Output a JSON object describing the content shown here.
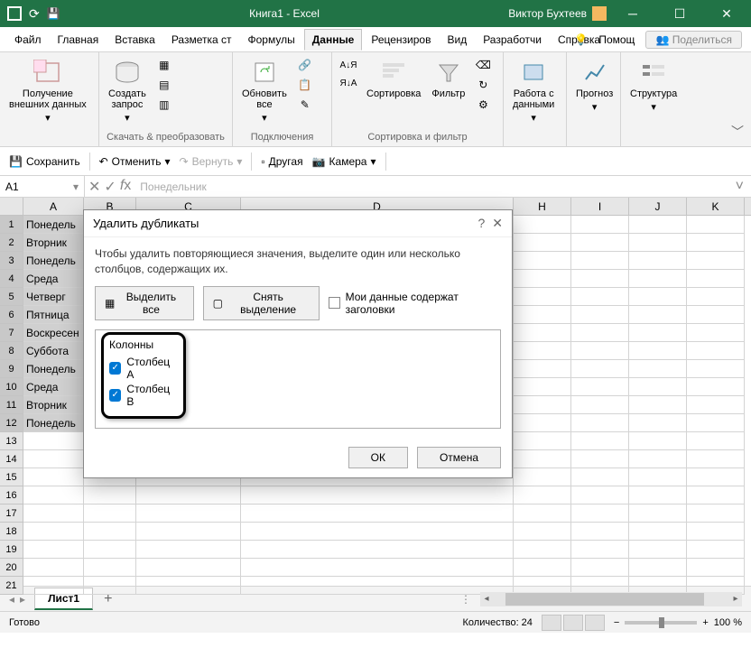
{
  "titlebar": {
    "filename": "Книга1 - Excel",
    "username": "Виктор Бухтеев"
  },
  "menu": {
    "items": [
      "Файл",
      "Главная",
      "Вставка",
      "Разметка ст",
      "Формулы",
      "Данные",
      "Рецензиров",
      "Вид",
      "Разработчи",
      "Справка"
    ],
    "active_index": 5,
    "help": "Помощ",
    "share": "Поделиться"
  },
  "ribbon": {
    "g1": {
      "btn": "Получение\nвнешних данных",
      "label": ""
    },
    "g2": {
      "btn": "Создать\nзапрос",
      "label": "Скачать & преобразовать"
    },
    "g3": {
      "btn": "Обновить\nвсе",
      "label": "Подключения"
    },
    "g4": {
      "sort": "Сортировка",
      "filter": "Фильтр",
      "label": "Сортировка и фильтр"
    },
    "g5": {
      "btn": "Работа с\nданными"
    },
    "g6": {
      "btn": "Прогноз"
    },
    "g7": {
      "btn": "Структура"
    }
  },
  "qat": {
    "save": "Сохранить",
    "undo": "Отменить",
    "redo": "Вернуть",
    "other": "Другая",
    "camera": "Камера"
  },
  "formula": {
    "namebox": "A1",
    "value": "Понедельник"
  },
  "columns": [
    "A",
    "B",
    "C",
    "D",
    "H",
    "I",
    "J",
    "K"
  ],
  "rows": [
    {
      "n": "1",
      "a": "Понедель"
    },
    {
      "n": "2",
      "a": "Вторник"
    },
    {
      "n": "3",
      "a": "Понедель"
    },
    {
      "n": "4",
      "a": "Среда"
    },
    {
      "n": "5",
      "a": "Четверг"
    },
    {
      "n": "6",
      "a": "Пятница"
    },
    {
      "n": "7",
      "a": "Воскресен"
    },
    {
      "n": "8",
      "a": "Суббота"
    },
    {
      "n": "9",
      "a": "Понедель"
    },
    {
      "n": "10",
      "a": "Среда"
    },
    {
      "n": "11",
      "a": "Вторник"
    },
    {
      "n": "12",
      "a": "Понедель"
    },
    {
      "n": "13",
      "a": ""
    },
    {
      "n": "14",
      "a": ""
    },
    {
      "n": "15",
      "a": ""
    },
    {
      "n": "16",
      "a": ""
    },
    {
      "n": "17",
      "a": ""
    },
    {
      "n": "18",
      "a": ""
    },
    {
      "n": "19",
      "a": ""
    },
    {
      "n": "20",
      "a": ""
    },
    {
      "n": "21",
      "a": ""
    }
  ],
  "sheet": {
    "name": "Лист1"
  },
  "status": {
    "ready": "Готово",
    "count": "Количество: 24",
    "zoom": "100 %"
  },
  "dialog": {
    "title": "Удалить дубликаты",
    "desc": "Чтобы удалить повторяющиеся значения, выделите один или несколько столбцов, содержащих их.",
    "select_all": "Выделить все",
    "deselect": "Снять выделение",
    "headers_cb": "Мои данные содержат заголовки",
    "cols_label": "Колонны",
    "col_a": "Столбец A",
    "col_b": "Столбец B",
    "ok": "ОК",
    "cancel": "Отмена"
  }
}
